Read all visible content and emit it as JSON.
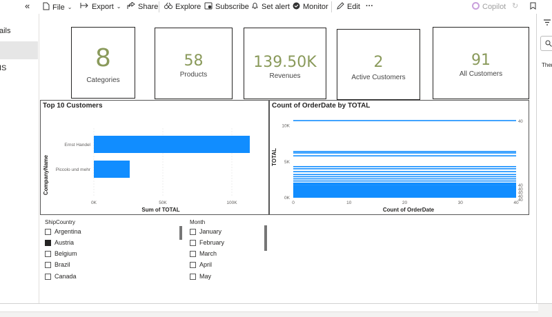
{
  "toolbar": {
    "collapse_glyph": "«",
    "file": "File",
    "export": "Export",
    "share": "Share",
    "explore": "Explore",
    "subscribe": "Subscribe",
    "set_alert": "Set alert",
    "monitor": "Monitor",
    "edit": "Edit",
    "more": "···",
    "copilot": "Copilot"
  },
  "leftnav": {
    "items": [
      "ails",
      "",
      "IS"
    ]
  },
  "cards": [
    {
      "value": "8",
      "label": "Categories"
    },
    {
      "value": "58",
      "label": "Products"
    },
    {
      "value": "139.50K",
      "label": "Revenues"
    },
    {
      "value": "2",
      "label": "Active Customers"
    },
    {
      "value": "91",
      "label": "All Customers"
    }
  ],
  "top_customers": {
    "title": "Top 10 Customers",
    "ylabel": "CompanyName",
    "xlabel": "Sum of TOTAL",
    "categories": [
      "Ernst Handel",
      "Piccolo und mehr"
    ],
    "values": [
      113000,
      26000
    ],
    "ticks": [
      "0K",
      "50K",
      "100K"
    ],
    "tick_values": [
      0,
      50000,
      100000
    ],
    "xmax": 125000,
    "color": "#118dff"
  },
  "count_chart": {
    "title": "Count of OrderDate by TOTAL",
    "ylabel": "TOTAL",
    "xlabel": "Count of OrderDate",
    "yticks": [
      "10K",
      "5K",
      "0K"
    ],
    "ytick_values": [
      10000,
      5000,
      0
    ],
    "xticks": [
      "0",
      "10",
      "20",
      "30",
      "40"
    ],
    "xtick_values": [
      0,
      10,
      20,
      30,
      40
    ],
    "xmax": 40,
    "ymax": 11500,
    "color": "#118dff",
    "bar_labels": [
      {
        "y": 10550,
        "text": "40"
      },
      {
        "y": 1650,
        "text": "40"
      },
      {
        "y": 1100,
        "text": "40"
      },
      {
        "y": 600,
        "text": "40"
      },
      {
        "y": 100,
        "text": "40"
      },
      {
        "y": -400,
        "text": "40"
      }
    ],
    "bar_y_values": [
      10600,
      6300,
      6100,
      5700,
      4200,
      3900,
      3500,
      3100,
      2800,
      2500,
      2200,
      1900,
      1600,
      1300,
      1100,
      900,
      700,
      500,
      300,
      100
    ]
  },
  "ship_slicer": {
    "title": "ShipCountry",
    "items": [
      {
        "label": "Argentina",
        "checked": false
      },
      {
        "label": "Austria",
        "checked": true
      },
      {
        "label": "Belgium",
        "checked": false
      },
      {
        "label": "Brazil",
        "checked": false
      },
      {
        "label": "Canada",
        "checked": false
      }
    ]
  },
  "month_slicer": {
    "title": "Month",
    "items": [
      {
        "label": "January",
        "checked": false
      },
      {
        "label": "February",
        "checked": false
      },
      {
        "label": "March",
        "checked": false
      },
      {
        "label": "April",
        "checked": false
      },
      {
        "label": "May",
        "checked": false
      }
    ]
  },
  "rightpane": {
    "text": "Ther"
  }
}
